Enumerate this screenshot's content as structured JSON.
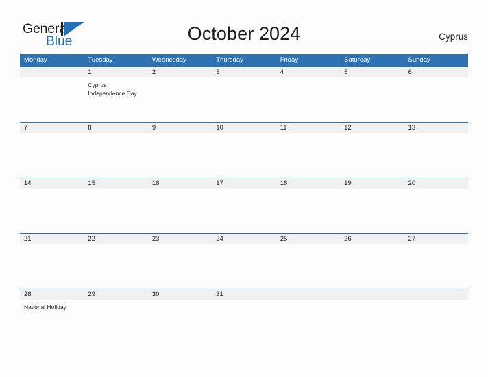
{
  "header": {
    "logo": {
      "text_primary": "General",
      "text_secondary": "Blue",
      "mark_icon": "general-blue-triangle-icon"
    },
    "title": "October 2024",
    "locale": "Cyprus"
  },
  "colors": {
    "header_blue": "#2F72B2",
    "logo_blue": "#2272BB",
    "date_strip_gray": "#F0F0F0",
    "page_background": "#FDFDFD",
    "text": "#1E1E1E"
  },
  "calendar": {
    "weekdays": [
      "Monday",
      "Tuesday",
      "Wednesday",
      "Thursday",
      "Friday",
      "Saturday",
      "Sunday"
    ],
    "weeks": [
      {
        "days": [
          {
            "date": "",
            "event": ""
          },
          {
            "date": "1",
            "event": "Cyprus\nIndependence Day"
          },
          {
            "date": "2",
            "event": ""
          },
          {
            "date": "3",
            "event": ""
          },
          {
            "date": "4",
            "event": ""
          },
          {
            "date": "5",
            "event": ""
          },
          {
            "date": "6",
            "event": ""
          }
        ]
      },
      {
        "days": [
          {
            "date": "7",
            "event": ""
          },
          {
            "date": "8",
            "event": ""
          },
          {
            "date": "9",
            "event": ""
          },
          {
            "date": "10",
            "event": ""
          },
          {
            "date": "11",
            "event": ""
          },
          {
            "date": "12",
            "event": ""
          },
          {
            "date": "13",
            "event": ""
          }
        ]
      },
      {
        "days": [
          {
            "date": "14",
            "event": ""
          },
          {
            "date": "15",
            "event": ""
          },
          {
            "date": "16",
            "event": ""
          },
          {
            "date": "17",
            "event": ""
          },
          {
            "date": "18",
            "event": ""
          },
          {
            "date": "19",
            "event": ""
          },
          {
            "date": "20",
            "event": ""
          }
        ]
      },
      {
        "days": [
          {
            "date": "21",
            "event": ""
          },
          {
            "date": "22",
            "event": ""
          },
          {
            "date": "23",
            "event": ""
          },
          {
            "date": "24",
            "event": ""
          },
          {
            "date": "25",
            "event": ""
          },
          {
            "date": "26",
            "event": ""
          },
          {
            "date": "27",
            "event": ""
          }
        ]
      },
      {
        "days": [
          {
            "date": "28",
            "event": "National Holiday"
          },
          {
            "date": "29",
            "event": ""
          },
          {
            "date": "30",
            "event": ""
          },
          {
            "date": "31",
            "event": ""
          },
          {
            "date": "",
            "event": ""
          },
          {
            "date": "",
            "event": ""
          },
          {
            "date": "",
            "event": ""
          }
        ]
      }
    ]
  }
}
